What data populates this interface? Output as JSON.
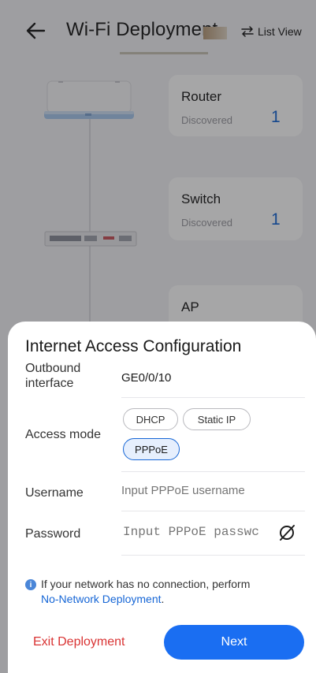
{
  "header": {
    "title": "Wi-Fi Deployment",
    "list_view_label": "List View"
  },
  "devices": [
    {
      "name": "Router",
      "status": "Discovered",
      "count": "1"
    },
    {
      "name": "Switch",
      "status": "Discovered",
      "count": "1"
    },
    {
      "name": "AP"
    }
  ],
  "sheet": {
    "title": "Internet Access Configuration",
    "outbound_label": "Outbound interface",
    "outbound_value": "GE0/0/10",
    "access_mode_label": "Access mode",
    "access_modes": [
      "DHCP",
      "Static IP",
      "PPPoE"
    ],
    "access_mode_selected": "PPPoE",
    "username_label": "Username",
    "username_placeholder": "Input PPPoE username",
    "password_label": "Password",
    "password_placeholder": "Input PPPoE passwc",
    "info_text": "If your network has no connection, perform",
    "info_link": "No-Network Deployment",
    "info_suffix": ".",
    "exit_label": "Exit Deployment",
    "next_label": "Next"
  },
  "colors": {
    "accent": "#1a6ef2",
    "danger": "#d93333",
    "link": "#1666d6"
  },
  "icons": [
    "back-arrow-icon",
    "list-view-icon",
    "eye-off-icon",
    "info-icon"
  ]
}
